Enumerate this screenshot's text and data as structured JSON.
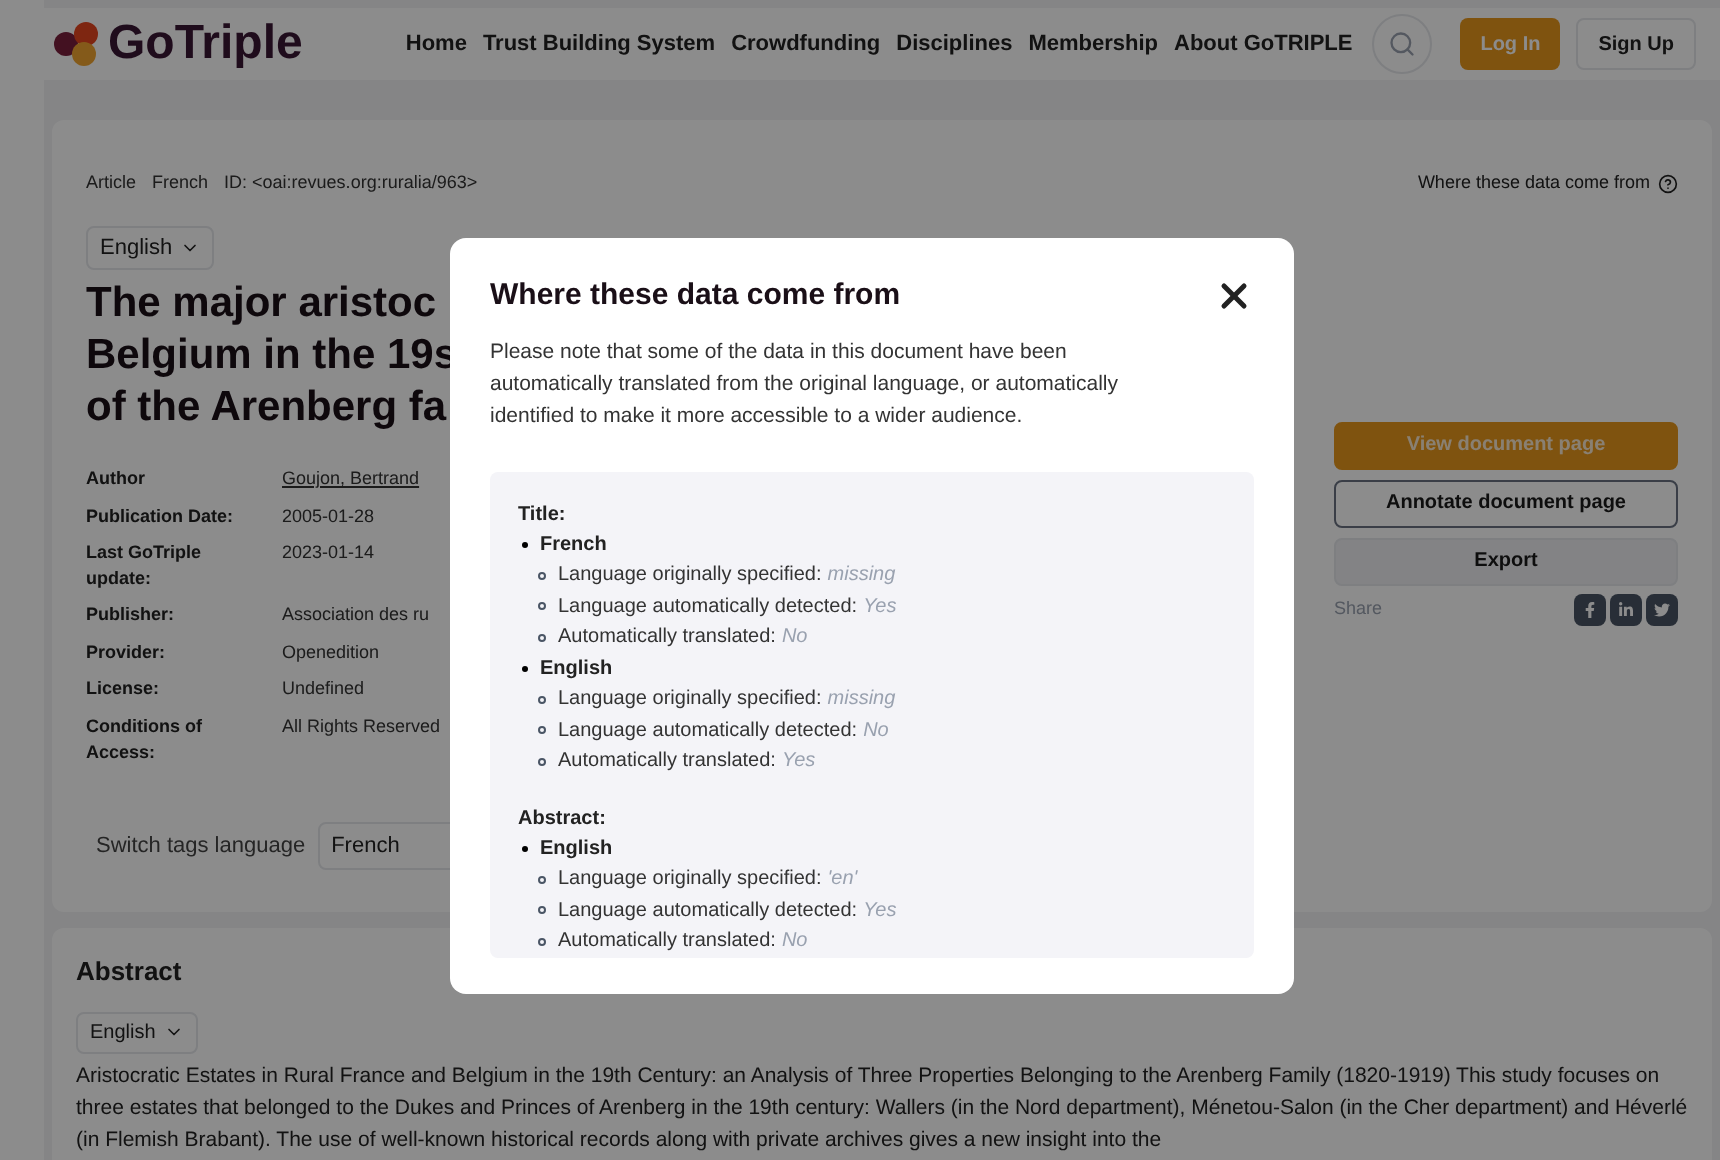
{
  "header": {
    "logo": "GoTriple",
    "nav": [
      "Home",
      "Trust Building System",
      "Crowdfunding",
      "Disciplines",
      "Membership",
      "About GoTRIPLE"
    ],
    "login": "Log In",
    "signup": "Sign Up"
  },
  "document": {
    "tags": [
      "Article",
      "French",
      "ID: <oai:revues.org:ruralia/963>"
    ],
    "provenance_link": "Where these data come from",
    "language": "English",
    "title_lines": [
      "The major aristoc",
      "Belgium in the 19s",
      "of the Arenberg fa"
    ],
    "meta": [
      {
        "label": "Author",
        "value": "Goujon, Bertrand",
        "kind": "link"
      },
      {
        "label": "Publication Date:",
        "value": "2005-01-28",
        "kind": "text"
      },
      {
        "label": "Last GoTriple update:",
        "value": "2023-01-14",
        "kind": "text"
      },
      {
        "label": "Publisher:",
        "value": "Association des ru",
        "kind": "text"
      },
      {
        "label": "Provider:",
        "value": "Openedition",
        "kind": "text"
      },
      {
        "label": "License:",
        "value": "Undefined",
        "kind": "text"
      },
      {
        "label": "Conditions of Access:",
        "value": "All Rights Reserved",
        "kind": "text"
      }
    ],
    "switch_label": "Switch tags language",
    "switch_value": "French",
    "actions": [
      {
        "label": "View document page",
        "kind": "primary"
      },
      {
        "label": "Annotate document page",
        "kind": "outline"
      },
      {
        "label": "Export",
        "kind": "plain"
      }
    ],
    "share": "Share"
  },
  "abstract": {
    "heading": "Abstract",
    "language": "English",
    "text": "Aristocratic Estates in Rural France and Belgium in the 19th Century: an Analysis of Three Properties Belonging to the Arenberg Family (1820-1919) This study focuses on three estates that belonged to the Dukes and Princes of Arenberg in the 19th century: Wallers (in the Nord department), Ménetou-Salon (in the Cher department) and Héverlé (in Flemish Brabant). The use of well-known historical records along with private archives gives a new insight into the"
  },
  "modal": {
    "title": "Where these data come from",
    "note": "Please note that some of the data in this document have been automatically translated from the original language, or automatically identified to make it more accessible to a wider audience.",
    "sections": [
      {
        "heading": "Title:",
        "languages": [
          {
            "name": "French",
            "items": [
              {
                "label": "Language originally specified:",
                "value": "missing"
              },
              {
                "label": "Language automatically detected:",
                "value": "Yes"
              },
              {
                "label": "Automatically translated:",
                "value": "No"
              }
            ]
          },
          {
            "name": "English",
            "items": [
              {
                "label": "Language originally specified:",
                "value": "missing"
              },
              {
                "label": "Language automatically detected:",
                "value": "No"
              },
              {
                "label": "Automatically translated:",
                "value": "Yes"
              }
            ]
          }
        ]
      },
      {
        "heading": "Abstract:",
        "languages": [
          {
            "name": "English",
            "items": [
              {
                "label": "Language originally specified:",
                "value": "'en'"
              },
              {
                "label": "Language automatically detected:",
                "value": "Yes"
              },
              {
                "label": "Automatically translated:",
                "value": "No"
              }
            ]
          }
        ]
      }
    ]
  }
}
